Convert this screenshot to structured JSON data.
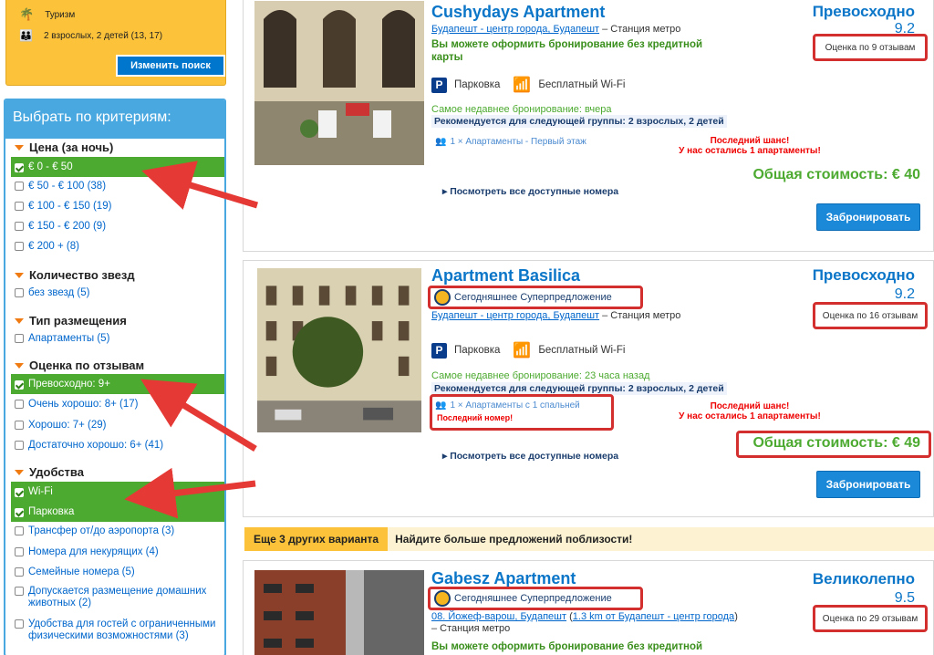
{
  "search": {
    "trip_type": "Туризм",
    "guests": "2 взрослых, 2 детей (13, 17)",
    "change_button": "Изменить поиск"
  },
  "filters": {
    "title": "Выбрать по критериям:",
    "price_title": "Цена (за ночь)",
    "price": [
      {
        "label": "€ 0 - € 50",
        "checked": true
      },
      {
        "label": "€ 50 - € 100 (38)",
        "checked": false
      },
      {
        "label": "€ 100 - € 150 (19)",
        "checked": false
      },
      {
        "label": "€ 150 - € 200 (9)",
        "checked": false
      },
      {
        "label": "€ 200 + (8)",
        "checked": false
      }
    ],
    "stars_title": "Количество звезд",
    "stars": [
      {
        "label": "без звезд (5)",
        "checked": false
      }
    ],
    "type_title": "Тип размещения",
    "type": [
      {
        "label": "Апартаменты (5)",
        "checked": false
      }
    ],
    "review_title": "Оценка по отзывам",
    "review": [
      {
        "label": "Превосходно: 9+",
        "checked": true
      },
      {
        "label": "Очень хорошо: 8+ (17)",
        "checked": false
      },
      {
        "label": "Хорошо: 7+ (29)",
        "checked": false
      },
      {
        "label": "Достаточно хорошо: 6+ (41)",
        "checked": false
      }
    ],
    "amenities_title": "Удобства",
    "amenities": [
      {
        "label": "Wi-Fi",
        "checked": true
      },
      {
        "label": "Парковка",
        "checked": true
      },
      {
        "label": "Трансфер от/до аэропорта (3)",
        "checked": false
      },
      {
        "label": "Номера для некурящих (4)",
        "checked": false
      },
      {
        "label": "Семейные номера (5)",
        "checked": false
      },
      {
        "label": "Допускается размещение домашних животных (2)",
        "checked": false
      },
      {
        "label": "Удобства для гостей с ограниченными физическими возможностями (3)",
        "checked": false
      }
    ]
  },
  "hotels": [
    {
      "name": "Cushydays Apartment",
      "address_link": "Будапешт - центр города, Будапешт",
      "address_rest": " – Станция метро",
      "no_card": "Вы можете оформить бронирование без кредитной карты",
      "parking": "Парковка",
      "wifi": "Бесплатный Wi-Fi",
      "recent": "Самое недавнее бронирование: вчера",
      "recommended": "Рекомендуется для следующей группы: 2 взрослых, 2 детей",
      "room": "1 × Апартаменты - Первый этаж",
      "last_chance": "Последний шанс!",
      "left": "У нас остались 1 апартаменты!",
      "see_all": "Посмотреть все доступные номера",
      "rating": "Превосходно",
      "score": "9.2",
      "reviews": "Оценка по 9 отзывам",
      "total": "Общая стоимость: € 40",
      "book": "Забронировать"
    },
    {
      "name": "Apartment Basilica",
      "deal": "Сегодняшнее Суперпредложение",
      "address_link": "Будапешт - центр города, Будапешт",
      "address_rest": " – Станция метро",
      "parking": "Парковка",
      "wifi": "Бесплатный Wi-Fi",
      "recent": "Самое недавнее бронирование: 23 часа назад",
      "recommended": "Рекомендуется для следующей группы: 2 взрослых, 2 детей",
      "room": "1 × Апартаменты с 1 спальней",
      "last_room": "Последний номер!",
      "last_chance": "Последний шанс!",
      "left": "У нас остались 1 апартаменты!",
      "see_all": "Посмотреть все доступные номера",
      "rating": "Превосходно",
      "score": "9.2",
      "reviews": "Оценка по 16 отзывам",
      "total": "Общая стоимость: € 49",
      "book": "Забронировать"
    },
    {
      "name": "Gabesz Apartment",
      "deal": "Сегодняшнее Суперпредложение",
      "address_link": "08. Йожеф-варош, Будапешт",
      "address_mid": "1.3 km от Будапешт - центр города",
      "address_rest": " – Станция метро",
      "no_card": "Вы можете оформить бронирование без кредитной",
      "rating": "Великолепно",
      "score": "9.5",
      "reviews": "Оценка по 29 отзывам"
    }
  ],
  "more": {
    "tag": "Еще 3 других варианта",
    "text": "Найдите больше предложений поблизости!"
  }
}
